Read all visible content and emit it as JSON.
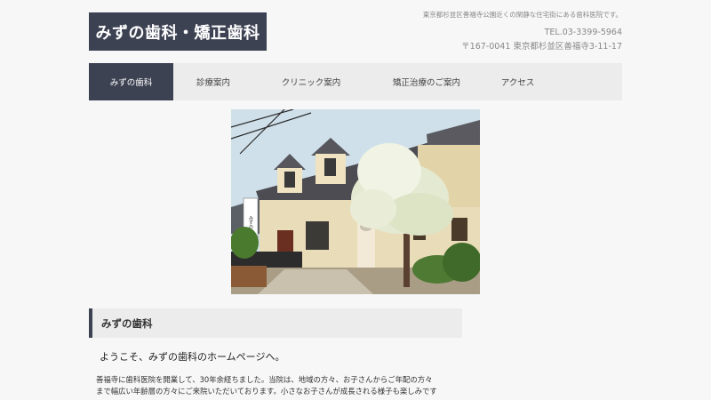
{
  "header": {
    "logo_text": "みずの歯科・矯正歯科",
    "tagline": "東京都杉並区善福寺公園近くの閑静な住宅街にある歯科医院です。",
    "tel": "TEL.03-3399-5964",
    "address": "〒167-0041 東京都杉並区善福寺3-11-17"
  },
  "nav": {
    "items": [
      {
        "label": "みずの歯科"
      },
      {
        "label": "診療案内"
      },
      {
        "label": "クリニック案内"
      },
      {
        "label": "矯正治療のご案内"
      },
      {
        "label": "アクセス"
      }
    ]
  },
  "main": {
    "heading": "みずの歯科",
    "welcome": "ようこそ、みずの歯科のホームページへ。",
    "body_line1": "善福寺に歯科医院を開業して、30年余経ちました。当院は、地域の方々、お子さんからご年配の方々",
    "body_line2": "まで幅広い年齢層の方々にご来院いただいております。小さなお子さんが成長される様子も楽しみです",
    "sign_text": "みずの歯科"
  },
  "colors": {
    "brand_navy": "#3d4253",
    "nav_bg": "#ececec",
    "page_bg": "#f7f7f7"
  }
}
